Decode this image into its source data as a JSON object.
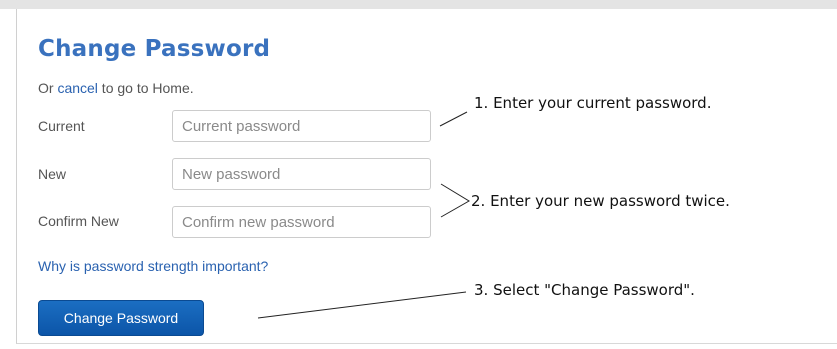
{
  "form": {
    "title": "Change Password",
    "cancel_prefix": "Or ",
    "cancel_link": "cancel",
    "cancel_suffix": " to go to Home.",
    "fields": [
      {
        "label": "Current",
        "placeholder": "Current password"
      },
      {
        "label": "New",
        "placeholder": "New password"
      },
      {
        "label": "Confirm New",
        "placeholder": "Confirm new password"
      }
    ],
    "strength_link": "Why is password strength important?",
    "submit_label": "Change Password"
  },
  "annotations": [
    "1. Enter your current password.",
    "2. Enter your new password twice.",
    "3. Select \"Change Password\"."
  ],
  "colors": {
    "title": "#3a72be",
    "link": "#2a62b0",
    "button": "#1165bb"
  }
}
